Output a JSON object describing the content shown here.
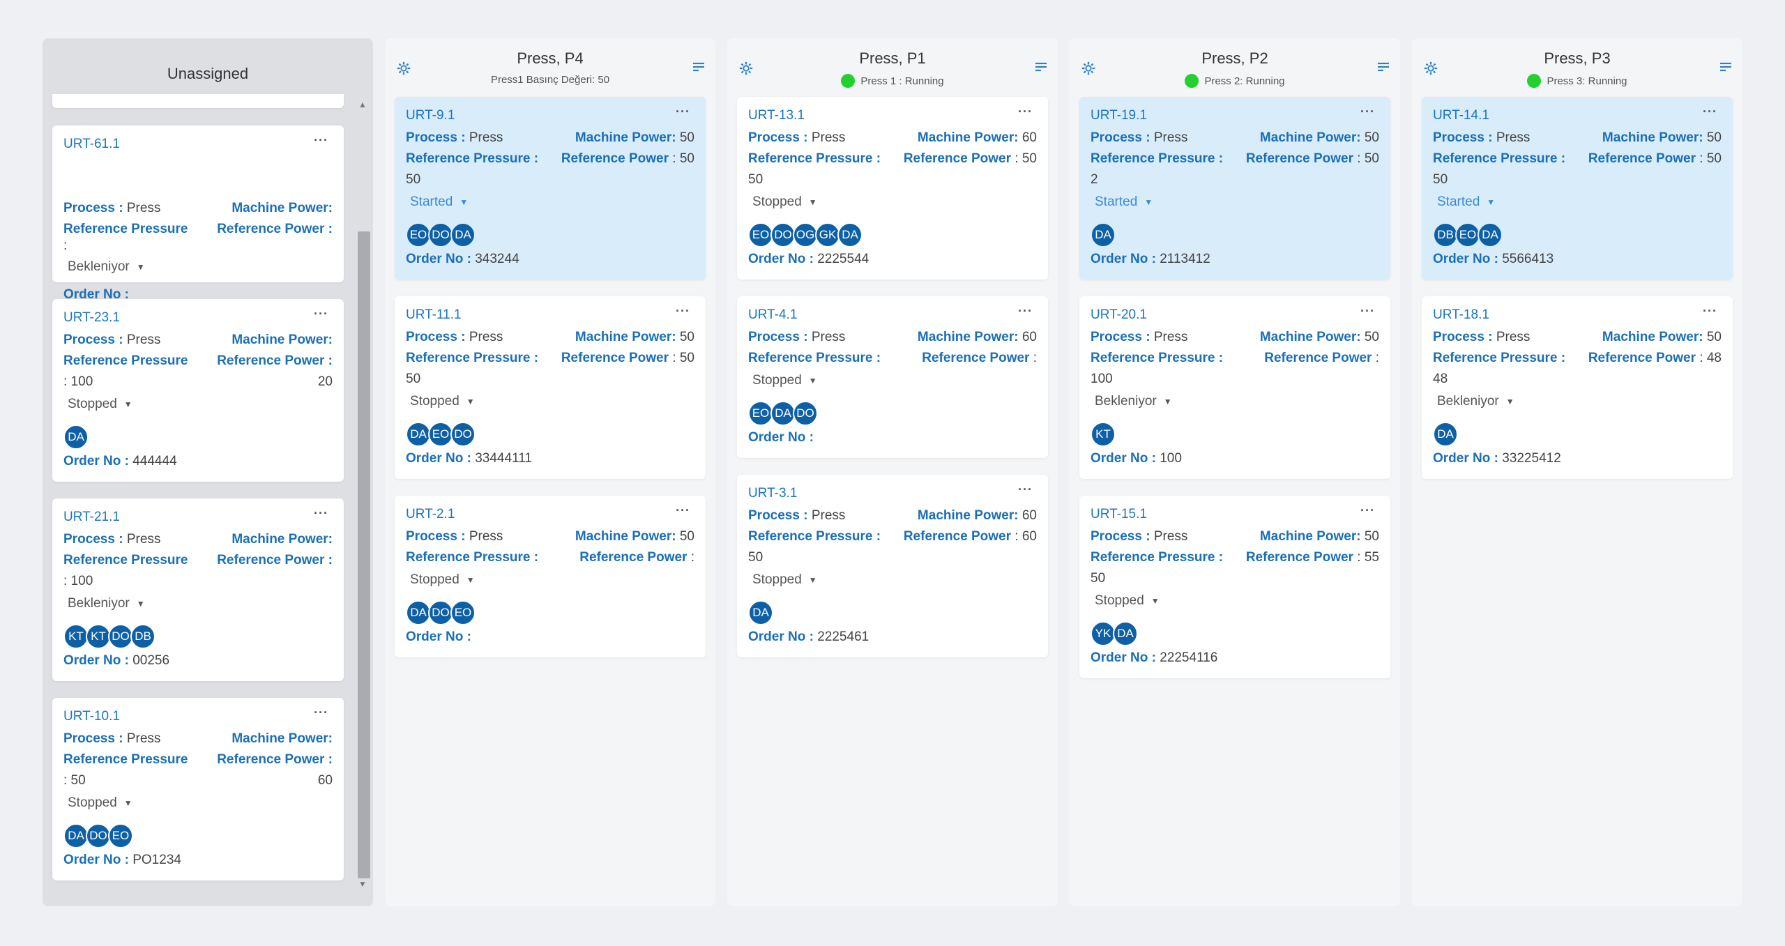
{
  "labels": {
    "process": "Process :",
    "machine_power": "Machine Power:",
    "reference_pressure": "Reference Pressure",
    "reference_pressure_colon": "Reference Pressure :",
    "reference_power": "Reference Power :",
    "order_no": "Order No :",
    "menu": "···"
  },
  "columns": {
    "unassigned": {
      "title": "Unassigned",
      "cards": [
        {
          "id": "URT-61.1",
          "process": "Press",
          "machine_power": "",
          "reference_pressure": ":",
          "reference_power": "",
          "status": "Bekleniyor",
          "avatars": [],
          "order_no": ""
        },
        {
          "id": "URT-23.1",
          "process": "Press",
          "machine_power": "",
          "reference_pressure": ": 100",
          "reference_power": "20",
          "status": "Stopped",
          "avatars": [
            "DA"
          ],
          "order_no": "444444"
        },
        {
          "id": "URT-21.1",
          "process": "Press",
          "machine_power": "",
          "reference_pressure": ": 100",
          "reference_power": "",
          "status": "Bekleniyor",
          "avatars": [
            "KT",
            "KT",
            "DO",
            "DB"
          ],
          "order_no": "00256"
        },
        {
          "id": "URT-10.1",
          "process": "Press",
          "machine_power": "",
          "reference_pressure": ": 50",
          "reference_power": "60",
          "status": "Stopped",
          "avatars": [
            "DA",
            "DO",
            "EO"
          ],
          "order_no": "PO1234"
        }
      ]
    },
    "p4": {
      "title": "Press, P4",
      "subtitle": "Press1 Basınç Değeri: 50",
      "cards": [
        {
          "id": "URT-9.1",
          "process": "Press",
          "machine_power": "50",
          "reference_power": ": 50",
          "reference_pressure": "50",
          "status": "Started",
          "avatars": [
            "EO",
            "DO",
            "DA"
          ],
          "order_no": "343244"
        },
        {
          "id": "URT-11.1",
          "process": "Press",
          "machine_power": "50",
          "reference_power": ": 50",
          "reference_pressure": "50",
          "status": "Stopped",
          "avatars": [
            "DA",
            "EO",
            "DO"
          ],
          "order_no": "33444111"
        },
        {
          "id": "URT-2.1",
          "process": "Press",
          "machine_power": "50",
          "reference_power": ":",
          "reference_pressure": "",
          "status": "Stopped",
          "avatars": [
            "DA",
            "DO",
            "EO"
          ],
          "order_no": ""
        }
      ]
    },
    "p1": {
      "title": "Press, P1",
      "subtitle": "Press 1 : Running",
      "cards": [
        {
          "id": "URT-13.1",
          "process": "Press",
          "machine_power": "60",
          "reference_power": ": 50",
          "reference_pressure": "50",
          "status": "Stopped",
          "avatars": [
            "EO",
            "DO",
            "OG",
            "GK",
            "DA"
          ],
          "order_no": "2225544"
        },
        {
          "id": "URT-4.1",
          "process": "Press",
          "machine_power": "60",
          "reference_power": ":",
          "reference_pressure": "",
          "status": "Stopped",
          "avatars": [
            "EO",
            "DA",
            "DO"
          ],
          "order_no": ""
        },
        {
          "id": "URT-3.1",
          "process": "Press",
          "machine_power": "60",
          "reference_power": ": 60",
          "reference_pressure": "50",
          "status": "Stopped",
          "avatars": [
            "DA"
          ],
          "order_no": "2225461"
        }
      ]
    },
    "p2": {
      "title": "Press, P2",
      "subtitle": "Press 2: Running",
      "cards": [
        {
          "id": "URT-19.1",
          "process": "Press",
          "machine_power": "50",
          "reference_power": ": 50",
          "reference_pressure": "2",
          "status": "Started",
          "avatars": [
            "DA"
          ],
          "order_no": "2113412"
        },
        {
          "id": "URT-20.1",
          "process": "Press",
          "machine_power": "50",
          "reference_power": ":",
          "reference_pressure": "100",
          "status": "Bekleniyor",
          "avatars": [
            "KT"
          ],
          "order_no": "100"
        },
        {
          "id": "URT-15.1",
          "process": "Press",
          "machine_power": "50",
          "reference_power": ": 55",
          "reference_pressure": "50",
          "status": "Stopped",
          "avatars": [
            "YK",
            "DA"
          ],
          "order_no": "22254116"
        }
      ]
    },
    "p3": {
      "title": "Press, P3",
      "subtitle": "Press 3: Running",
      "cards": [
        {
          "id": "URT-14.1",
          "process": "Press",
          "machine_power": "50",
          "reference_power": ": 50",
          "reference_pressure": "50",
          "status": "Started",
          "avatars": [
            "DB",
            "EO",
            "DA"
          ],
          "order_no": "5566413"
        },
        {
          "id": "URT-18.1",
          "process": "Press",
          "machine_power": "50",
          "reference_power": ": 48",
          "reference_pressure": "48",
          "status": "Bekleniyor",
          "avatars": [
            "DA"
          ],
          "order_no": "33225412"
        }
      ]
    }
  },
  "colors": {
    "accent": "#1a75c4",
    "active_card": "#d9ecfa",
    "avatar": "#0d5fa6",
    "running": "#22d12f"
  },
  "icons": {
    "settings": "gear-icon",
    "filter": "filter-icon",
    "menu": "more-icon"
  }
}
